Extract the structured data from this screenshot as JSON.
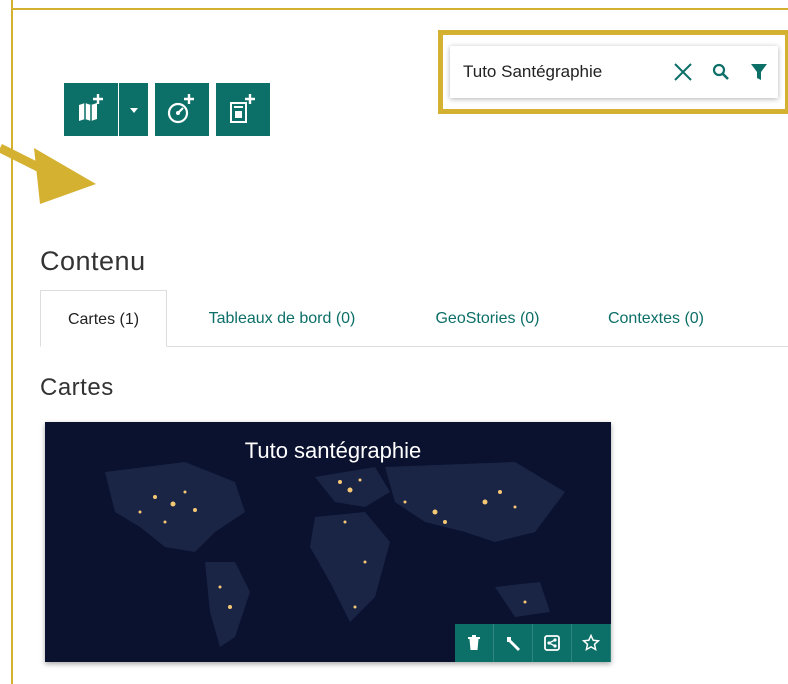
{
  "search": {
    "value": "Tuto Santégraphie",
    "clear_icon": "close-icon",
    "search_icon": "search-icon",
    "filter_icon": "filter-icon"
  },
  "toolbar": {
    "icons": [
      "new-map-icon",
      "caret-down-icon",
      "new-dashboard-icon",
      "new-geostory-icon"
    ]
  },
  "content": {
    "title": "Contenu",
    "tabs": [
      {
        "label": "Cartes (1)"
      },
      {
        "label": "Tableaux de bord (0)"
      },
      {
        "label": "GeoStories (0)"
      },
      {
        "label": "Contextes (0)"
      }
    ]
  },
  "maps_section": {
    "title": "Cartes",
    "cards": [
      {
        "title": "Tuto santégraphie",
        "actions": [
          "trash-icon",
          "wrench-icon",
          "share-icon",
          "star-icon"
        ]
      }
    ]
  },
  "colors": {
    "accent": "#0c6f68",
    "highlight": "#d4b131",
    "card_bg": "#0b1230"
  }
}
